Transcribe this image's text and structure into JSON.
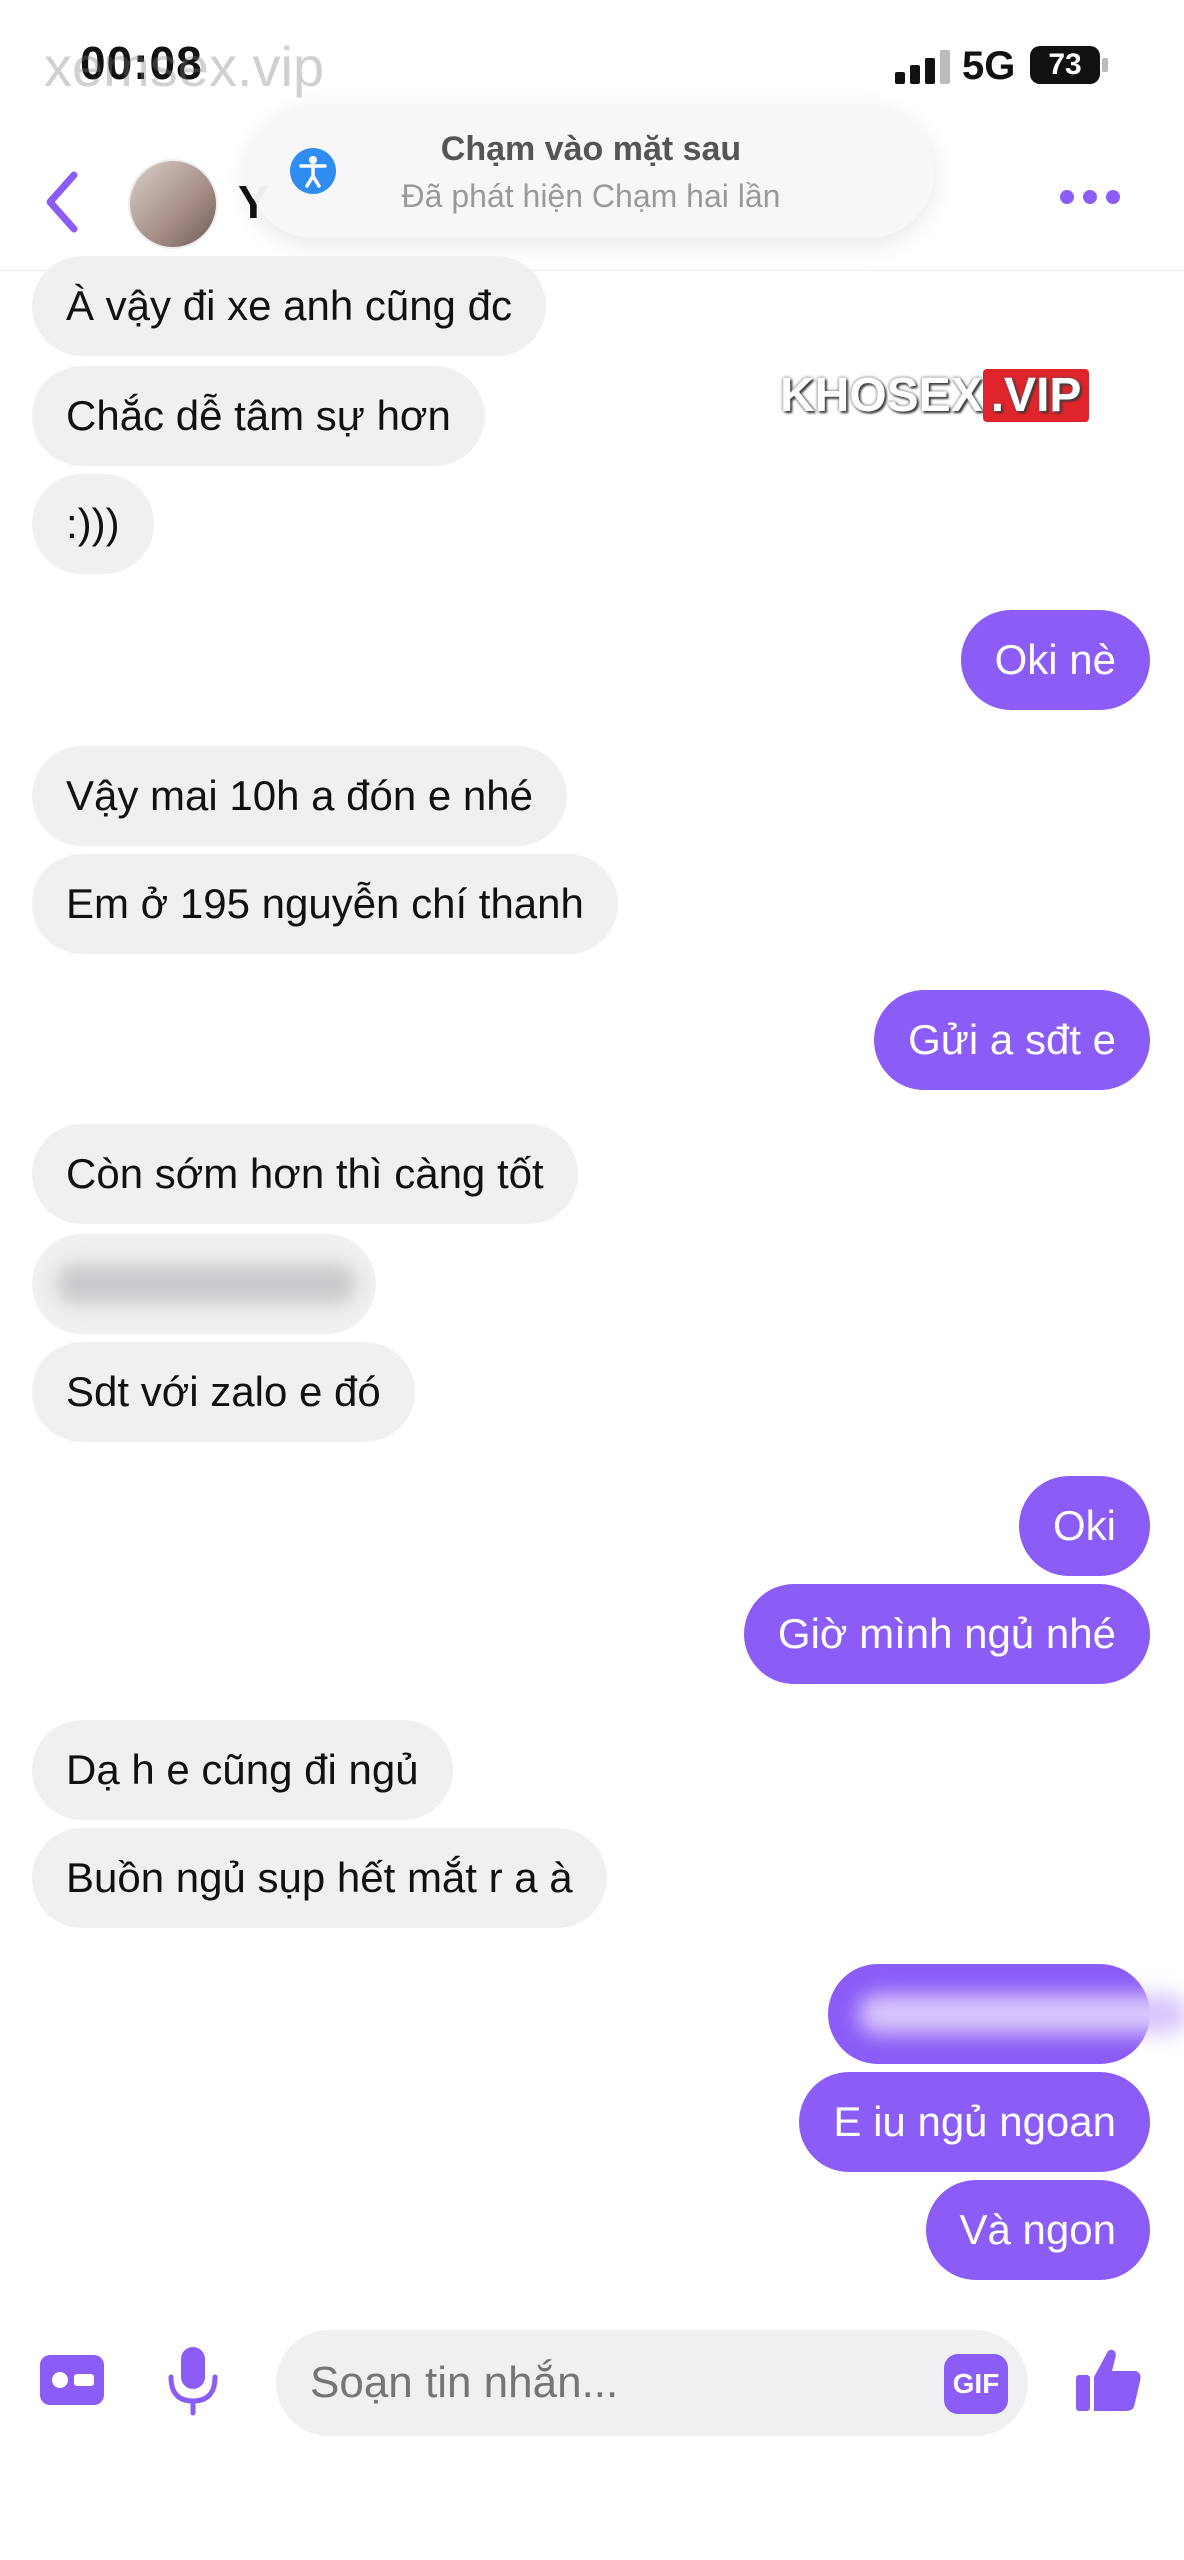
{
  "status_bar": {
    "time": "00:08",
    "watermark": "xemsex.vip",
    "network": "5G",
    "battery": "73"
  },
  "header": {
    "contact_initial": "Y",
    "back_icon": "chevron-left-icon",
    "more_icon": "more-dots-icon"
  },
  "toast": {
    "title": "Chạm vào mặt sau",
    "subtitle": "Đã phát hiện Chạm hai lần"
  },
  "watermark": {
    "left": "KHOSEX",
    "right": ".VIP"
  },
  "messages": [
    {
      "side": "in",
      "text": "À vậy đi xe anh cũng đc"
    },
    {
      "side": "in",
      "text": "Chắc dễ tâm sự hơn"
    },
    {
      "side": "in",
      "text": ":)))"
    },
    {
      "side": "out",
      "text": "Oki nè"
    },
    {
      "side": "in",
      "text": "Vậy mai 10h a đón e nhé"
    },
    {
      "side": "in",
      "text": "Em ở 195 nguyễn chí thanh"
    },
    {
      "side": "out",
      "text": "Gửi a sđt e"
    },
    {
      "side": "in",
      "text": "Còn sớm hơn thì càng tốt"
    },
    {
      "side": "in",
      "text": "",
      "blurred": true
    },
    {
      "side": "in",
      "text": "Sdt với zalo e đó"
    },
    {
      "side": "out",
      "text": "Oki"
    },
    {
      "side": "out",
      "text": "Giờ mình ngủ nhé"
    },
    {
      "side": "in",
      "text": "Dạ h e cũng đi ngủ"
    },
    {
      "side": "in",
      "text": "Buồn ngủ sụp hết mắt r a à"
    },
    {
      "side": "out",
      "text": "",
      "blurred": true
    },
    {
      "side": "out",
      "text": "E iu ngủ ngoan"
    },
    {
      "side": "out",
      "text": "Và ngon"
    }
  ],
  "composer": {
    "placeholder": "Soạn tin nhắn...",
    "gif_label": "GIF"
  },
  "colors": {
    "accent": "#8b5cf6",
    "incoming_bubble": "#f0f0f3"
  }
}
